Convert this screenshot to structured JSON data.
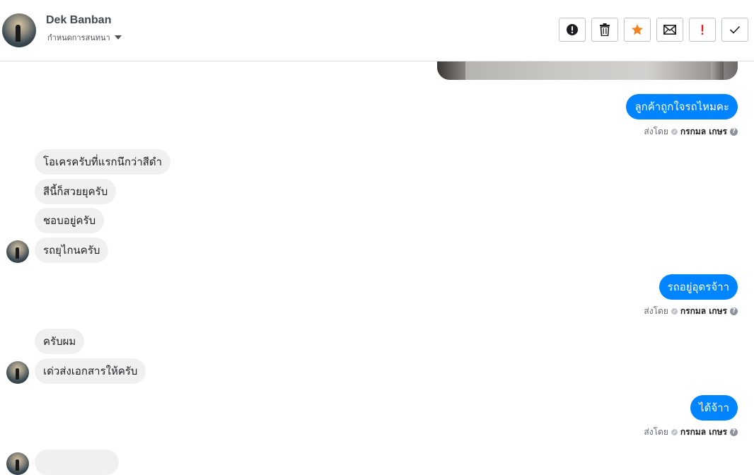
{
  "header": {
    "contact_name": "Dek Banban",
    "conversation_settings": "กำหนดการสนทนา"
  },
  "toolbar": {
    "buttons": [
      {
        "name": "report-spam",
        "icon": "exclamation-circle-icon"
      },
      {
        "name": "delete",
        "icon": "trash-icon"
      },
      {
        "name": "star",
        "icon": "star-icon",
        "color": "#f5821f"
      },
      {
        "name": "mark-unread",
        "icon": "envelope-icon"
      },
      {
        "name": "mark-important",
        "icon": "exclamation-icon",
        "color": "#e02020"
      },
      {
        "name": "mark-done",
        "icon": "checkmark-icon"
      }
    ]
  },
  "messages": {
    "out1": "ลูกค้าถูกใจรถไหมคะ",
    "in1": "โอเครครับที่แรกนึกว่าสีดำ",
    "in2": "สีนี้ก็สวยยุครับ",
    "in3": "ชอบอยู่ครับ",
    "in4": "รถยุไกนครับ",
    "out2": "รถอยู่อุดรจ้าา",
    "in5": "ครับผม",
    "in6": "เด่วส่งเอกสารให้ครับ",
    "out3": "ได้จ้าา"
  },
  "sent_by": {
    "label": "ส่งโดย",
    "agent": "กรกมล เกษร"
  },
  "colors": {
    "outgoing_bubble": "#0084ff",
    "incoming_bubble": "#f1f0f0"
  }
}
